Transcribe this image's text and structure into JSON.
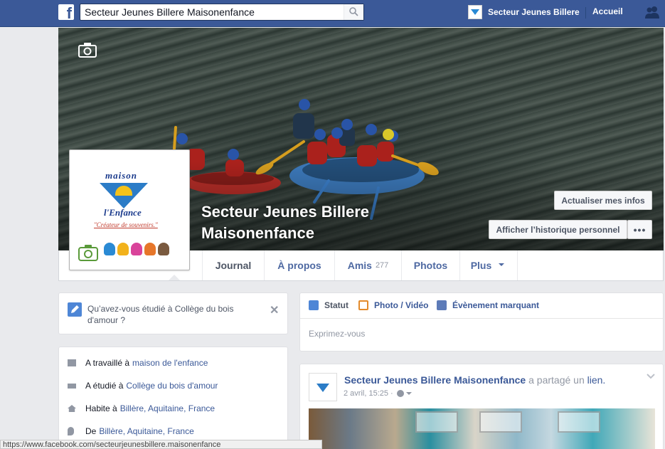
{
  "topbar": {
    "logo": "f",
    "search_value": "Secteur Jeunes Billere Maisonenfance",
    "profile_name": "Secteur Jeunes Billere",
    "home_label": "Accueil"
  },
  "cover": {
    "page_name": "Secteur Jeunes Billere Maisonenfance",
    "update_button": "Actualiser mes infos",
    "history_button": "Afficher l’historique personnel",
    "more_button": "•••"
  },
  "profile_pic": {
    "logo_top": "maison",
    "logo_bottom": "l'Enfance",
    "slogan": "\"Créateur de souvenirs.\""
  },
  "tabs": [
    {
      "label": "Journal",
      "active": true
    },
    {
      "label": "À propos"
    },
    {
      "label": "Amis",
      "count": "277"
    },
    {
      "label": "Photos"
    },
    {
      "label": "Plus"
    }
  ],
  "question": {
    "text": "Qu’avez-vous étudié à Collège du bois d'amour ?"
  },
  "about": [
    {
      "text": "A travaillé à",
      "link": "maison de l'enfance"
    },
    {
      "text": "A étudié à",
      "link": "Collège du bois d'amour"
    },
    {
      "text": "Habite à",
      "link": "Billère, Aquitaine, France"
    },
    {
      "text": "De",
      "link": "Billère, Aquitaine, France"
    }
  ],
  "composer": {
    "tabs": [
      {
        "label": "Statut",
        "active": true
      },
      {
        "label": "Photo / Vidéo"
      },
      {
        "label": "Évènement marquant"
      }
    ],
    "placeholder": "Exprimez-vous"
  },
  "post": {
    "author": "Secteur Jeunes Billere Maisonenfance",
    "action": "a partagé un",
    "object": "lien.",
    "date": "2 avril, 15:25 ·"
  },
  "statusbar": "https://www.facebook.com/secteurjeunesbillere.maisonenfance",
  "colors": {
    "brand": "#3b5998",
    "background": "#e9eaed"
  }
}
